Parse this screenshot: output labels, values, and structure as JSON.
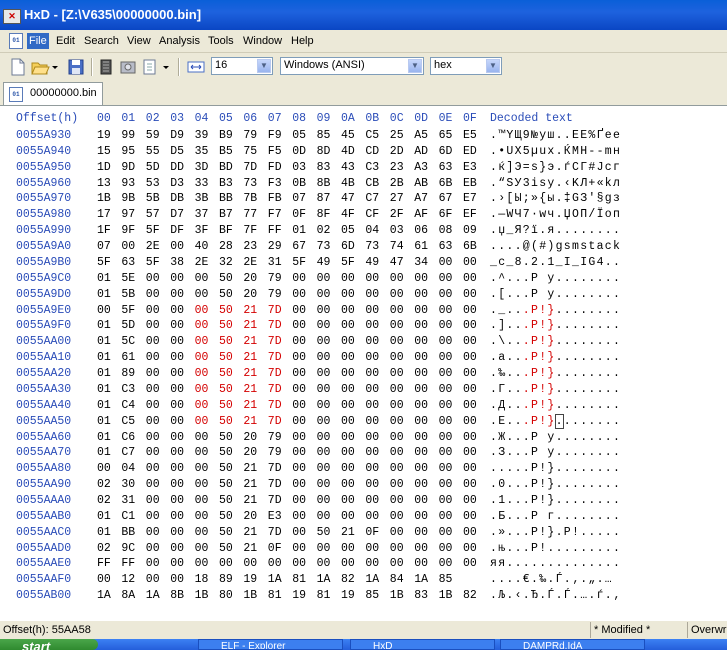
{
  "window": {
    "title": "HxD - [Z:\\V635\\00000000.bin]",
    "app_icon_text": "HxD"
  },
  "menu": [
    "File",
    "Edit",
    "Search",
    "View",
    "Analysis",
    "Tools",
    "Window",
    "Help"
  ],
  "toolbar": {
    "bytes_per_row": "16",
    "charset": "Windows (ANSI)",
    "offset_base": "hex"
  },
  "tab": {
    "label": "00000000.bin"
  },
  "header": {
    "offset": "Offset(h)",
    "columns": [
      "00",
      "01",
      "02",
      "03",
      "04",
      "05",
      "06",
      "07",
      "08",
      "09",
      "0A",
      "0B",
      "0C",
      "0D",
      "0E",
      "0F"
    ],
    "decoded": "Decoded text"
  },
  "rows": [
    {
      "offset": "0055A930",
      "bytes": [
        "19",
        "99",
        "59",
        "D9",
        "39",
        "B9",
        "79",
        "F9",
        "05",
        "85",
        "45",
        "C5",
        "25",
        "A5",
        "65",
        "E5"
      ],
      "text": ".™YЩ9№уш..EЕ%Ґeе"
    },
    {
      "offset": "0055A940",
      "bytes": [
        "15",
        "95",
        "55",
        "D5",
        "35",
        "B5",
        "75",
        "F5",
        "0D",
        "8D",
        "4D",
        "CD",
        "2D",
        "AD",
        "6D",
        "ED"
      ],
      "text": ".•UХ5µuх.ЌМН--mн"
    },
    {
      "offset": "0055A950",
      "bytes": [
        "1D",
        "9D",
        "5D",
        "DD",
        "3D",
        "BD",
        "7D",
        "FD",
        "03",
        "83",
        "43",
        "C3",
        "23",
        "A3",
        "63",
        "E3"
      ],
      "text": ".ќ]Э=ѕ}э.ѓСГ#Јcг"
    },
    {
      "offset": "0055A960",
      "bytes": [
        "13",
        "93",
        "53",
        "D3",
        "33",
        "B3",
        "73",
        "F3",
        "0B",
        "8B",
        "4B",
        "CB",
        "2B",
        "AB",
        "6B",
        "EB"
      ],
      "text": ".“SУ3іsу.‹KЛ+«kл"
    },
    {
      "offset": "0055A970",
      "bytes": [
        "1B",
        "9B",
        "5B",
        "DB",
        "3B",
        "BB",
        "7B",
        "FB",
        "07",
        "87",
        "47",
        "C7",
        "27",
        "A7",
        "67",
        "E7"
      ],
      "text": ".›[Ы;»{ы.‡GЗ'§gз"
    },
    {
      "offset": "0055A980",
      "bytes": [
        "17",
        "97",
        "57",
        "D7",
        "37",
        "B7",
        "77",
        "F7",
        "0F",
        "8F",
        "4F",
        "CF",
        "2F",
        "AF",
        "6F",
        "EF"
      ],
      "text": ".—WЧ7·wч.ЏOП/Їoп"
    },
    {
      "offset": "0055A990",
      "bytes": [
        "1F",
        "9F",
        "5F",
        "DF",
        "3F",
        "BF",
        "7F",
        "FF",
        "01",
        "02",
        "05",
        "04",
        "03",
        "06",
        "08",
        "09"
      ],
      "text": ".џ_Я?ї.я........"
    },
    {
      "offset": "0055A9A0",
      "bytes": [
        "07",
        "00",
        "2E",
        "00",
        "40",
        "28",
        "23",
        "29",
        "67",
        "73",
        "6D",
        "73",
        "74",
        "61",
        "63",
        "6B"
      ],
      "text": "....@(#)gsmstack"
    },
    {
      "offset": "0055A9B0",
      "bytes": [
        "5F",
        "63",
        "5F",
        "38",
        "2E",
        "32",
        "2E",
        "31",
        "5F",
        "49",
        "5F",
        "49",
        "47",
        "34",
        "00",
        "00"
      ],
      "text": "_c_8.2.1_I_IG4.."
    },
    {
      "offset": "0055A9C0",
      "bytes": [
        "01",
        "5E",
        "00",
        "00",
        "00",
        "50",
        "20",
        "79",
        "00",
        "00",
        "00",
        "00",
        "00",
        "00",
        "00",
        "00"
      ],
      "text": ".^...P y........"
    },
    {
      "offset": "0055A9D0",
      "bytes": [
        "01",
        "5B",
        "00",
        "00",
        "00",
        "50",
        "20",
        "79",
        "00",
        "00",
        "00",
        "00",
        "00",
        "00",
        "00",
        "00"
      ],
      "text": ".[...P y........"
    },
    {
      "offset": "0055A9E0",
      "bytes": [
        "00",
        "5F",
        "00",
        "00",
        "00",
        "50",
        "21",
        "7D",
        "00",
        "00",
        "00",
        "00",
        "00",
        "00",
        "00",
        "00"
      ],
      "text": "._...P!}........",
      "red": [
        4,
        5,
        6,
        7
      ]
    },
    {
      "offset": "0055A9F0",
      "bytes": [
        "01",
        "5D",
        "00",
        "00",
        "00",
        "50",
        "21",
        "7D",
        "00",
        "00",
        "00",
        "00",
        "00",
        "00",
        "00",
        "00"
      ],
      "text": ".]...P!}........",
      "red": [
        4,
        5,
        6,
        7
      ]
    },
    {
      "offset": "0055AA00",
      "bytes": [
        "01",
        "5C",
        "00",
        "00",
        "00",
        "50",
        "21",
        "7D",
        "00",
        "00",
        "00",
        "00",
        "00",
        "00",
        "00",
        "00"
      ],
      "text": ".\\...P!}........",
      "red": [
        4,
        5,
        6,
        7
      ]
    },
    {
      "offset": "0055AA10",
      "bytes": [
        "01",
        "61",
        "00",
        "00",
        "00",
        "50",
        "21",
        "7D",
        "00",
        "00",
        "00",
        "00",
        "00",
        "00",
        "00",
        "00"
      ],
      "text": ".a...P!}........",
      "red": [
        4,
        5,
        6,
        7
      ]
    },
    {
      "offset": "0055AA20",
      "bytes": [
        "01",
        "89",
        "00",
        "00",
        "00",
        "50",
        "21",
        "7D",
        "00",
        "00",
        "00",
        "00",
        "00",
        "00",
        "00",
        "00"
      ],
      "text": ".‰...P!}........",
      "red": [
        4,
        5,
        6,
        7
      ]
    },
    {
      "offset": "0055AA30",
      "bytes": [
        "01",
        "C3",
        "00",
        "00",
        "00",
        "50",
        "21",
        "7D",
        "00",
        "00",
        "00",
        "00",
        "00",
        "00",
        "00",
        "00"
      ],
      "text": ".Г...P!}........",
      "red": [
        4,
        5,
        6,
        7
      ]
    },
    {
      "offset": "0055AA40",
      "bytes": [
        "01",
        "C4",
        "00",
        "00",
        "00",
        "50",
        "21",
        "7D",
        "00",
        "00",
        "00",
        "00",
        "00",
        "00",
        "00",
        "00"
      ],
      "text": ".Д...P!}........",
      "red": [
        4,
        5,
        6,
        7
      ]
    },
    {
      "offset": "0055AA50",
      "bytes": [
        "01",
        "C5",
        "00",
        "00",
        "00",
        "50",
        "21",
        "7D",
        "00",
        "00",
        "00",
        "00",
        "00",
        "00",
        "00",
        "00"
      ],
      "text": ".Е...P!}........",
      "red": [
        4,
        5,
        6,
        7
      ],
      "caret": 8
    },
    {
      "offset": "0055AA60",
      "bytes": [
        "01",
        "C6",
        "00",
        "00",
        "00",
        "50",
        "20",
        "79",
        "00",
        "00",
        "00",
        "00",
        "00",
        "00",
        "00",
        "00"
      ],
      "text": ".Ж...P y........"
    },
    {
      "offset": "0055AA70",
      "bytes": [
        "01",
        "C7",
        "00",
        "00",
        "00",
        "50",
        "20",
        "79",
        "00",
        "00",
        "00",
        "00",
        "00",
        "00",
        "00",
        "00"
      ],
      "text": ".З...P y........"
    },
    {
      "offset": "0055AA80",
      "bytes": [
        "00",
        "04",
        "00",
        "00",
        "00",
        "50",
        "21",
        "7D",
        "00",
        "00",
        "00",
        "00",
        "00",
        "00",
        "00",
        "00"
      ],
      "text": ".....P!}........"
    },
    {
      "offset": "0055AA90",
      "bytes": [
        "02",
        "30",
        "00",
        "00",
        "00",
        "50",
        "21",
        "7D",
        "00",
        "00",
        "00",
        "00",
        "00",
        "00",
        "00",
        "00"
      ],
      "text": ".0...P!}........"
    },
    {
      "offset": "0055AAA0",
      "bytes": [
        "02",
        "31",
        "00",
        "00",
        "00",
        "50",
        "21",
        "7D",
        "00",
        "00",
        "00",
        "00",
        "00",
        "00",
        "00",
        "00"
      ],
      "text": ".1...P!}........"
    },
    {
      "offset": "0055AAB0",
      "bytes": [
        "01",
        "C1",
        "00",
        "00",
        "00",
        "50",
        "20",
        "E3",
        "00",
        "00",
        "00",
        "00",
        "00",
        "00",
        "00",
        "00"
      ],
      "text": ".Б...P г........"
    },
    {
      "offset": "0055AAC0",
      "bytes": [
        "01",
        "BB",
        "00",
        "00",
        "00",
        "50",
        "21",
        "7D",
        "00",
        "50",
        "21",
        "0F",
        "00",
        "00",
        "00",
        "00"
      ],
      "text": ".»...P!}.P!....."
    },
    {
      "offset": "0055AAD0",
      "bytes": [
        "02",
        "9C",
        "00",
        "00",
        "00",
        "50",
        "21",
        "0F",
        "00",
        "00",
        "00",
        "00",
        "00",
        "00",
        "00",
        "00"
      ],
      "text": ".њ...P!........."
    },
    {
      "offset": "0055AAE0",
      "bytes": [
        "FF",
        "FF",
        "00",
        "00",
        "00",
        "00",
        "00",
        "00",
        "00",
        "00",
        "00",
        "00",
        "00",
        "00",
        "00",
        "00"
      ],
      "text": "яя.............."
    },
    {
      "offset": "0055AAF0",
      "bytes": [
        "00",
        "12",
        "00",
        "00",
        "18",
        "89",
        "19",
        "1A",
        "81",
        "1A",
        "82",
        "1A",
        "84",
        "1A",
        "85"
      ],
      "text": "....€.‰.Ѓ.‚.„.…"
    },
    {
      "offset": "0055AB00",
      "bytes": [
        "1A",
        "8A",
        "1A",
        "8B",
        "1B",
        "80",
        "1B",
        "81",
        "19",
        "81",
        "19",
        "85",
        "1B",
        "83",
        "1B",
        "82"
      ],
      "text": ".Љ.‹.Ђ.Ѓ.Ѓ.….ѓ.‚"
    }
  ],
  "status": {
    "offset": "Offset(h): 55AA58",
    "modified": "* Modified *",
    "mode": "Overwrite"
  },
  "taskbar": {
    "start": "start",
    "tasks": [
      "ELF - Explorer",
      "HxD",
      "DAMPRd.IdA"
    ]
  }
}
